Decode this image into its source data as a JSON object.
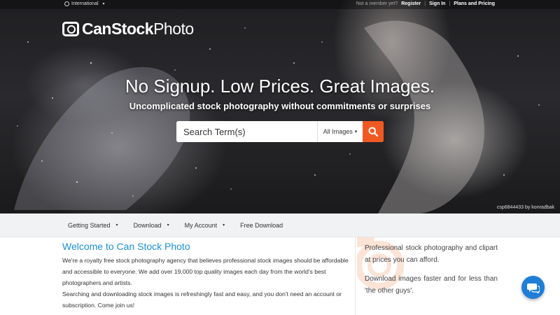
{
  "topbar": {
    "language": "International",
    "not_member": "Not a member yet?",
    "register": "Register",
    "sign_in": "Sign In",
    "plans": "Plans and Pricing",
    "separator": "|"
  },
  "logo": {
    "bold": "CanStock",
    "light": "Photo"
  },
  "hero": {
    "headline": "No Signup. Low Prices. Great Images.",
    "subhead": "Uncomplicated stock photography without commitments or surprises",
    "search_placeholder": "Search Term(s)",
    "search_type": "All Images",
    "credit": "csp6844433 by konradbak"
  },
  "nav": {
    "items": [
      {
        "label": "Getting Started",
        "dropdown": true
      },
      {
        "label": "Download",
        "dropdown": true
      },
      {
        "label": "My Account",
        "dropdown": true
      },
      {
        "label": "Free Download",
        "dropdown": false
      }
    ]
  },
  "main": {
    "title": "Welcome to Can Stock Photo",
    "p1": "We're a royalty free stock photography agency that believes professional stock images should be affordable and accessible to everyone. We add over 19,000 top quality images each day from the world's best photographers and artists.",
    "p2": "Searching and downloading stock images is refreshingly fast and easy, and you don't need an account or subscription. Come join us!"
  },
  "side": {
    "s1": "Professional stock photography and clipart at prices you can afford.",
    "s2": "Download images faster and for less than 'the other guys'."
  },
  "colors": {
    "accent": "#f05a22",
    "link": "#1a90d0",
    "chat": "#1f7ed8"
  },
  "icons": [
    "globe-icon",
    "camera-logo-icon",
    "search-icon",
    "chat-icon",
    "chevron-down-icon"
  ]
}
